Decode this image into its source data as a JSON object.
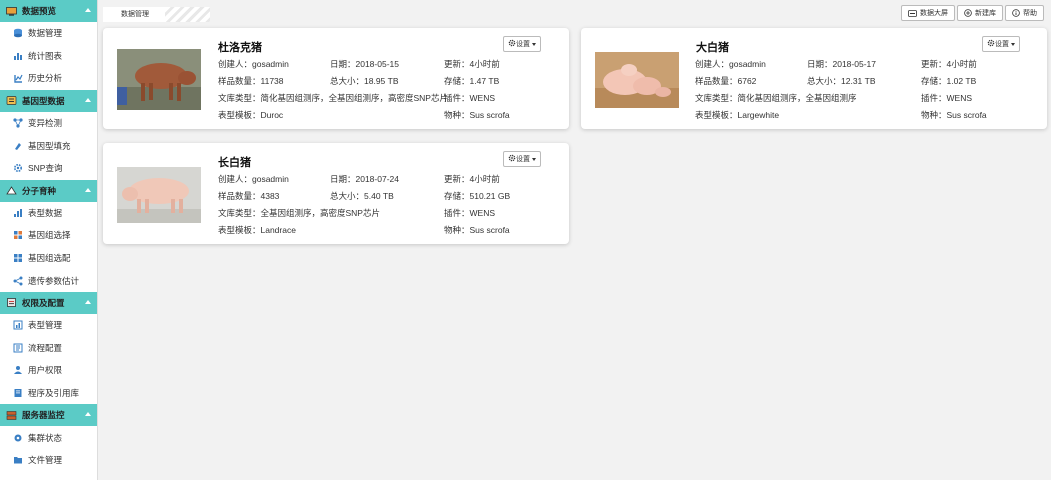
{
  "sidebar": {
    "groups": [
      {
        "label": "数据预览",
        "items": [
          "数据管理",
          "统计图表",
          "历史分析"
        ]
      },
      {
        "label": "基因型数据",
        "items": [
          "变异检测",
          "基因型填充",
          "SNP查询"
        ]
      },
      {
        "label": "分子育种",
        "items": [
          "表型数据",
          "基因组选择",
          "基因组选配",
          "遗传参数估计"
        ]
      },
      {
        "label": "权限及配置",
        "items": [
          "表型管理",
          "流程配置",
          "用户权限",
          "程序及引用库"
        ]
      },
      {
        "label": "服务器监控",
        "items": [
          "集群状态",
          "文件管理"
        ]
      }
    ]
  },
  "topbar": {
    "tab": "数据管理",
    "buttons": {
      "screen": "数据大屏",
      "new": "新建库",
      "help": "帮助"
    }
  },
  "gear_label": "设置",
  "cards": [
    {
      "title": "杜洛克猪",
      "creator": "创建人：gosadmin",
      "date": "日期：2018-05-15",
      "updated": "更新：4小时前",
      "samples": "样品数量：11738",
      "total": "总大小：18.95 TB",
      "storage": "存储：1.47 TB",
      "lib": "文库类型：简化基因组测序，全基因组测序，高密度SNP芯片",
      "plugin": "插件：WENS",
      "template": "表型模板：Duroc",
      "species": "物种：Sus scrofa"
    },
    {
      "title": "大白猪",
      "creator": "创建人：gosadmin",
      "date": "日期：2018-05-17",
      "updated": "更新：4小时前",
      "samples": "样品数量：6762",
      "total": "总大小：12.31 TB",
      "storage": "存储：1.02 TB",
      "lib": "文库类型：简化基因组测序，全基因组测序",
      "plugin": "插件：WENS",
      "template": "表型模板：Largewhite",
      "species": "物种：Sus scrofa"
    },
    {
      "title": "长白猪",
      "creator": "创建人：gosadmin",
      "date": "日期：2018-07-24",
      "updated": "更新：4小时前",
      "samples": "样品数量：4383",
      "total": "总大小：5.40 TB",
      "storage": "存储：510.21 GB",
      "lib": "文库类型：全基因组测序，高密度SNP芯片",
      "plugin": "插件：WENS",
      "template": "表型模板：Landrace",
      "species": "物种：Sus scrofa"
    }
  ]
}
